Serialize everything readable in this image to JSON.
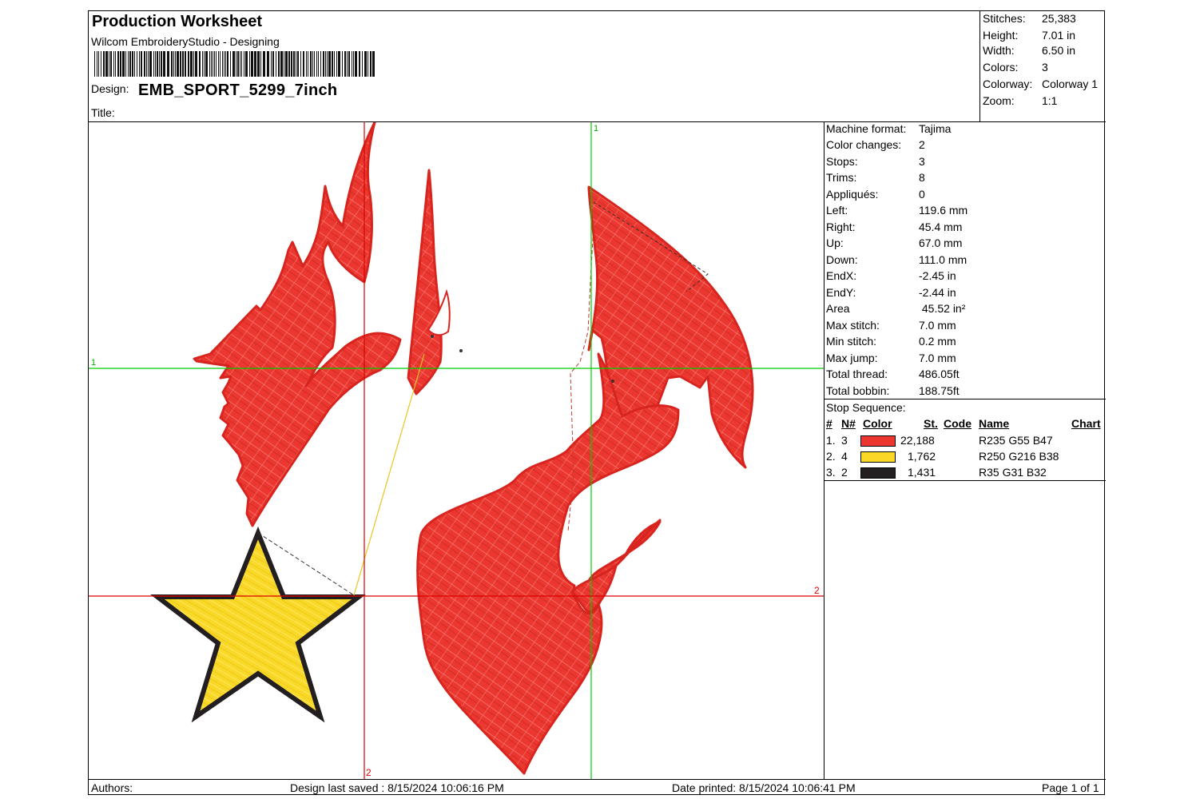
{
  "header": {
    "title": "Production Worksheet",
    "subtitle": "Wilcom EmbroideryStudio - Designing",
    "design_label": "Design:",
    "design_name": "EMB_SPORT_5299_7inch",
    "title_label": "Title:"
  },
  "stats": [
    {
      "label": "Stitches:",
      "value": "25,383"
    },
    {
      "label": "Height:",
      "value": "7.01 in"
    },
    {
      "label": "Width:",
      "value": "6.50 in"
    },
    {
      "label": "Colors:",
      "value": "3"
    },
    {
      "label": "Colorway:",
      "value": "Colorway 1"
    },
    {
      "label": "Zoom:",
      "value": "1:1"
    }
  ],
  "machine_info": [
    {
      "label": "Machine format:",
      "value": "Tajima"
    },
    {
      "label": "Color changes:",
      "value": "2"
    },
    {
      "label": "Stops:",
      "value": "3"
    },
    {
      "label": "Trims:",
      "value": "8"
    },
    {
      "label": "Appliqués:",
      "value": "0"
    },
    {
      "label": "Left:",
      "value": "119.6 mm"
    },
    {
      "label": "Right:",
      "value": "45.4 mm"
    },
    {
      "label": "Up:",
      "value": "67.0 mm"
    },
    {
      "label": "Down:",
      "value": "111.0 mm"
    },
    {
      "label": "EndX:",
      "value": "-2.45 in"
    },
    {
      "label": "EndY:",
      "value": "-2.44 in"
    },
    {
      "label": "Area",
      "value": " 45.52 in²"
    },
    {
      "label": "Max stitch:",
      "value": "7.0 mm"
    },
    {
      "label": "Min stitch:",
      "value": "0.2 mm"
    },
    {
      "label": "Max jump:",
      "value": "7.0 mm"
    },
    {
      "label": "Total thread:",
      "value": "486.05ft"
    },
    {
      "label": "Total bobbin:",
      "value": "188.75ft"
    }
  ],
  "stop_sequence": {
    "title": "Stop Sequence:",
    "headers": {
      "num": "#",
      "needle": "N#",
      "color": "Color",
      "stitches": "St.",
      "code": "Code",
      "name": "Name",
      "chart": "Chart"
    },
    "rows": [
      {
        "num": "1.",
        "needle": "3",
        "swatch": "#eb372f",
        "stitches": "22,188",
        "name": "R235 G55 B47"
      },
      {
        "num": "2.",
        "needle": "4",
        "swatch": "#fad826",
        "stitches": "1,762",
        "name": "R250 G216 B38"
      },
      {
        "num": "3.",
        "needle": "2",
        "swatch": "#231f20",
        "stitches": "1,431",
        "name": "R35 G31 B32"
      }
    ]
  },
  "canvas": {
    "guide_labels": {
      "green_v": "1",
      "green_h": "1",
      "red_h": "2",
      "red_v": "2"
    },
    "colors": {
      "fill_red": "#eb372f",
      "outline_red": "#d8241e",
      "star_yellow": "#fad826",
      "star_outline": "#231f20",
      "guide_green": "#00cc00",
      "guide_red": "#dd0000"
    }
  },
  "footer": {
    "authors": "Authors:",
    "saved": "Design last saved : 8/15/2024 10:06:16 PM",
    "printed": "Date printed: 8/15/2024 10:06:41 PM",
    "page": "Page 1 of 1"
  }
}
